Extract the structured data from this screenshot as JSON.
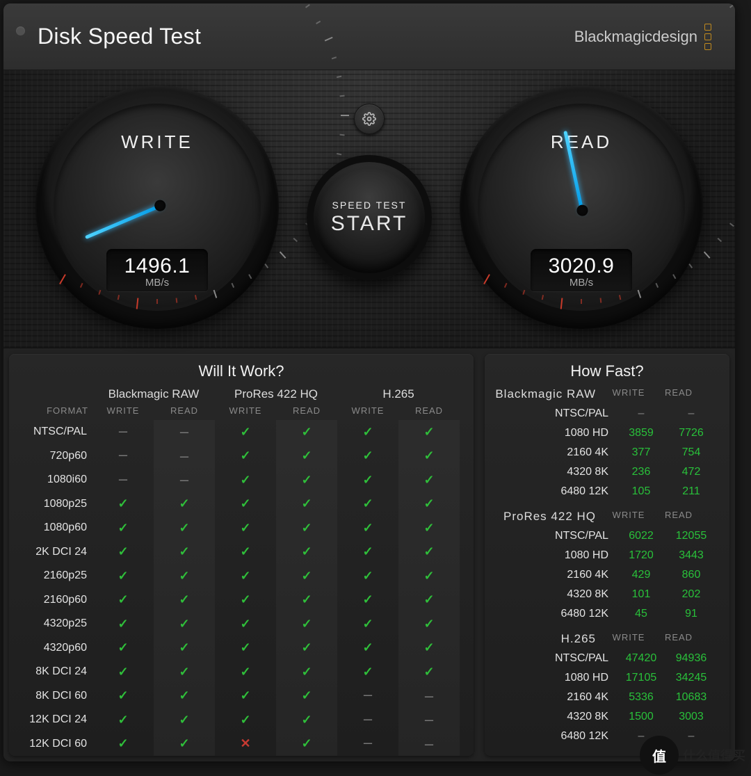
{
  "header": {
    "title": "Disk Speed Test",
    "brand": "Blackmagicdesign"
  },
  "gauges": {
    "write": {
      "label": "WRITE",
      "value": "1496.1",
      "unit": "MB/s",
      "needle_deg": -203
    },
    "read": {
      "label": "READ",
      "value": "3020.9",
      "unit": "MB/s",
      "needle_deg": -102
    }
  },
  "start": {
    "small": "SPEED TEST",
    "big": "START"
  },
  "wiw": {
    "title": "Will It Work?",
    "format_header": "FORMAT",
    "codecs": [
      "Blackmagic RAW",
      "ProRes 422 HQ",
      "H.265"
    ],
    "sub": [
      "WRITE",
      "READ",
      "WRITE",
      "READ",
      "WRITE",
      "READ"
    ],
    "rows": [
      {
        "f": "NTSC/PAL",
        "c": [
          "-",
          "-",
          "y",
          "y",
          "y",
          "y"
        ]
      },
      {
        "f": "720p60",
        "c": [
          "-",
          "-",
          "y",
          "y",
          "y",
          "y"
        ]
      },
      {
        "f": "1080i60",
        "c": [
          "-",
          "-",
          "y",
          "y",
          "y",
          "y"
        ]
      },
      {
        "f": "1080p25",
        "c": [
          "y",
          "y",
          "y",
          "y",
          "y",
          "y"
        ]
      },
      {
        "f": "1080p60",
        "c": [
          "y",
          "y",
          "y",
          "y",
          "y",
          "y"
        ]
      },
      {
        "f": "2K DCI 24",
        "c": [
          "y",
          "y",
          "y",
          "y",
          "y",
          "y"
        ]
      },
      {
        "f": "2160p25",
        "c": [
          "y",
          "y",
          "y",
          "y",
          "y",
          "y"
        ]
      },
      {
        "f": "2160p60",
        "c": [
          "y",
          "y",
          "y",
          "y",
          "y",
          "y"
        ]
      },
      {
        "f": "4320p25",
        "c": [
          "y",
          "y",
          "y",
          "y",
          "y",
          "y"
        ]
      },
      {
        "f": "4320p60",
        "c": [
          "y",
          "y",
          "y",
          "y",
          "y",
          "y"
        ]
      },
      {
        "f": "8K DCI 24",
        "c": [
          "y",
          "y",
          "y",
          "y",
          "y",
          "y"
        ]
      },
      {
        "f": "8K DCI 60",
        "c": [
          "y",
          "y",
          "y",
          "y",
          "-",
          "-"
        ]
      },
      {
        "f": "12K DCI 24",
        "c": [
          "y",
          "y",
          "y",
          "y",
          "-",
          "-"
        ]
      },
      {
        "f": "12K DCI 60",
        "c": [
          "y",
          "y",
          "x",
          "y",
          "-",
          "-"
        ]
      }
    ]
  },
  "hf": {
    "title": "How Fast?",
    "cols": [
      "WRITE",
      "READ"
    ],
    "sections": [
      {
        "codec": "Blackmagic RAW",
        "rows": [
          {
            "f": "NTSC/PAL",
            "w": "-",
            "r": "-"
          },
          {
            "f": "1080 HD",
            "w": "3859",
            "r": "7726"
          },
          {
            "f": "2160 4K",
            "w": "377",
            "r": "754"
          },
          {
            "f": "4320 8K",
            "w": "236",
            "r": "472"
          },
          {
            "f": "6480 12K",
            "w": "105",
            "r": "211"
          }
        ]
      },
      {
        "codec": "ProRes 422 HQ",
        "rows": [
          {
            "f": "NTSC/PAL",
            "w": "6022",
            "r": "12055"
          },
          {
            "f": "1080 HD",
            "w": "1720",
            "r": "3443"
          },
          {
            "f": "2160 4K",
            "w": "429",
            "r": "860"
          },
          {
            "f": "4320 8K",
            "w": "101",
            "r": "202"
          },
          {
            "f": "6480 12K",
            "w": "45",
            "r": "91"
          }
        ]
      },
      {
        "codec": "H.265",
        "rows": [
          {
            "f": "NTSC/PAL",
            "w": "47420",
            "r": "94936"
          },
          {
            "f": "1080 HD",
            "w": "17105",
            "r": "34245"
          },
          {
            "f": "2160 4K",
            "w": "5336",
            "r": "10683"
          },
          {
            "f": "4320 8K",
            "w": "1500",
            "r": "3003"
          },
          {
            "f": "6480 12K",
            "w": "-",
            "r": "-"
          }
        ]
      }
    ]
  },
  "watermark": {
    "circle": "值",
    "text": "什么值得买"
  }
}
